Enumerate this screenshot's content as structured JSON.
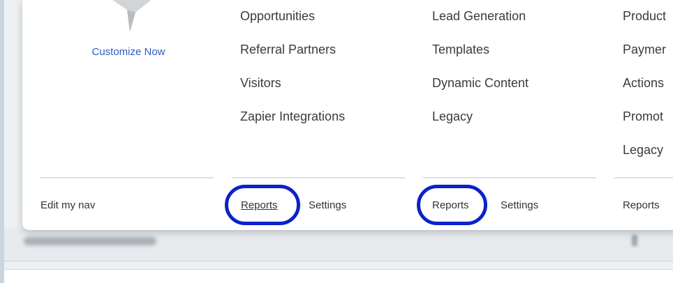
{
  "menu": {
    "customize_label": "Customize Now",
    "edit_nav_label": "Edit my nav",
    "columns": [
      {
        "items": [
          "Opportunities",
          "Referral Partners",
          "Visitors",
          "Zapier Integrations"
        ],
        "reports_label": "Reports",
        "settings_label": "Settings"
      },
      {
        "items": [
          "Lead Generation",
          "Templates",
          "Dynamic Content",
          "Legacy"
        ],
        "reports_label": "Reports",
        "settings_label": "Settings"
      },
      {
        "items": [
          "Product",
          "Paymer",
          "Actions",
          "Promot",
          "Legacy"
        ],
        "reports_label": "Reports"
      }
    ]
  },
  "colors": {
    "highlight_ring": "#0a22c8",
    "customize_link": "#2c5cc5"
  }
}
